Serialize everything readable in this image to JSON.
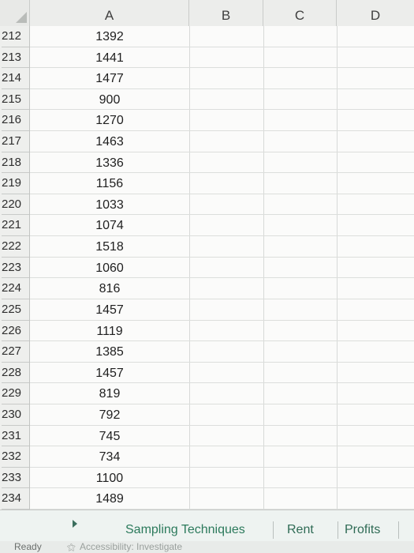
{
  "columns": [
    "A",
    "B",
    "C",
    "D"
  ],
  "rows": [
    {
      "num": "212",
      "a": "1392"
    },
    {
      "num": "213",
      "a": "1441"
    },
    {
      "num": "214",
      "a": "1477"
    },
    {
      "num": "215",
      "a": "900"
    },
    {
      "num": "216",
      "a": "1270"
    },
    {
      "num": "217",
      "a": "1463"
    },
    {
      "num": "218",
      "a": "1336"
    },
    {
      "num": "219",
      "a": "1156"
    },
    {
      "num": "220",
      "a": "1033"
    },
    {
      "num": "221",
      "a": "1074"
    },
    {
      "num": "222",
      "a": "1518"
    },
    {
      "num": "223",
      "a": "1060"
    },
    {
      "num": "224",
      "a": "816"
    },
    {
      "num": "225",
      "a": "1457"
    },
    {
      "num": "226",
      "a": "1119"
    },
    {
      "num": "227",
      "a": "1385"
    },
    {
      "num": "228",
      "a": "1457"
    },
    {
      "num": "229",
      "a": "819"
    },
    {
      "num": "230",
      "a": "792"
    },
    {
      "num": "231",
      "a": "745"
    },
    {
      "num": "232",
      "a": "734"
    },
    {
      "num": "233",
      "a": "1100"
    },
    {
      "num": "234",
      "a": "1489"
    }
  ],
  "sheet_tabs": [
    "Sampling Techniques",
    "Rent",
    "Profits"
  ],
  "status": {
    "ready": "Ready",
    "accessibility": "Accessibility: Investigate"
  },
  "icons": {
    "corner": "select-all-icon",
    "scroll": "scroll-right-icon",
    "accessibility": "accessibility-icon"
  },
  "colors": {
    "tab_text": "#2c7a5c",
    "grid_line": "#d7d9d7"
  }
}
